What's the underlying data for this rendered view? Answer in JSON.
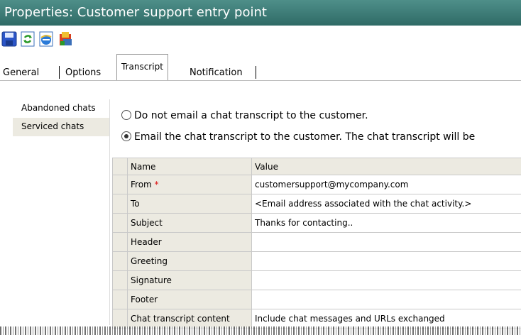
{
  "window": {
    "title": "Properties: Customer support entry point"
  },
  "toolbar": {
    "buttons": [
      {
        "icon": "save-icon"
      },
      {
        "icon": "refresh-icon"
      },
      {
        "icon": "browser-icon"
      },
      {
        "icon": "properties-icon"
      }
    ]
  },
  "tabs": [
    {
      "label": "General"
    },
    {
      "label": "Options"
    },
    {
      "label": "Transcript",
      "active": true
    },
    {
      "label": "Notification"
    }
  ],
  "left_pane": {
    "items": [
      {
        "label": "Abandoned chats"
      },
      {
        "label": "Serviced chats",
        "selected": true
      }
    ]
  },
  "options": {
    "no_email_label": "Do not email a chat transcript to the customer.",
    "email_label": "Email the chat transcript to the customer. The chat transcript will be",
    "selected": "email"
  },
  "grid": {
    "headers": {
      "name": "Name",
      "value": "Value"
    },
    "rows": [
      {
        "name": "From",
        "required_mark": "*",
        "value": "customersupport@mycompany.com"
      },
      {
        "name": "To",
        "value": "<Email address associated with the chat activity.>"
      },
      {
        "name": "Subject",
        "value": "Thanks for contacting.."
      },
      {
        "name": "Header",
        "value": ""
      },
      {
        "name": "Greeting",
        "value": ""
      },
      {
        "name": "Signature",
        "value": ""
      },
      {
        "name": "Footer",
        "value": ""
      },
      {
        "name": "Chat transcript content",
        "value": "Include chat messages and URLs exchanged"
      }
    ]
  }
}
